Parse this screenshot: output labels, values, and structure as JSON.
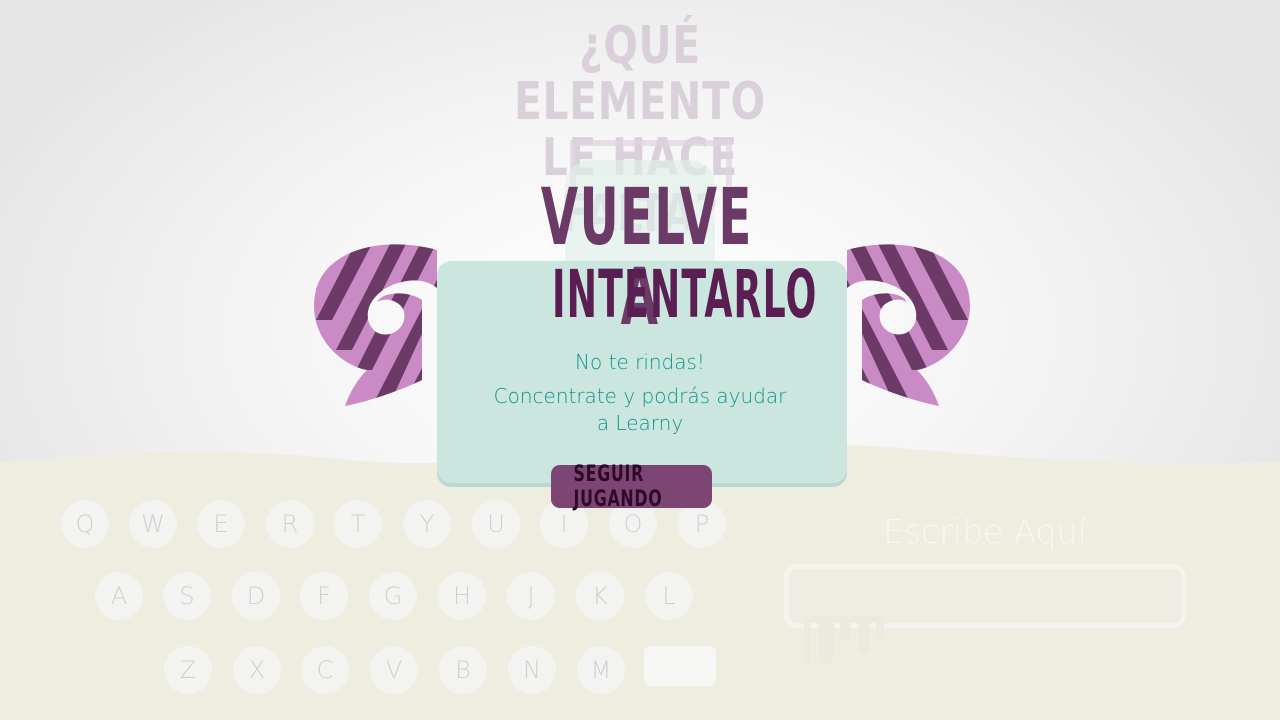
{
  "background": {
    "title_line1": "¿QUÉ ELEMENTO",
    "title_line2": "LE HACE FALTA?"
  },
  "keyboard": {
    "row1": [
      "Q",
      "W",
      "E",
      "R",
      "T",
      "Y",
      "U",
      "I",
      "O",
      "P"
    ],
    "row2": [
      "A",
      "S",
      "D",
      "F",
      "G",
      "H",
      "J",
      "K",
      "L"
    ],
    "row3": [
      "Z",
      "X",
      "C",
      "V",
      "B",
      "N",
      "M"
    ],
    "action_key": ""
  },
  "answer": {
    "label": "Escribe Aquí",
    "value": ""
  },
  "modal": {
    "title_line1": "VUELVE A",
    "title_line2": "INTENTARLO",
    "message1": "No te rindas!",
    "message2": "Concentrate y podrás ayudar",
    "message3": "a Learny",
    "button_label": "SEGUIR JUGANDO"
  },
  "colors": {
    "panel": "#cbe6df",
    "title": "#6b3a67",
    "button": "#7d4574",
    "message": "#11958a",
    "horn_light": "#c98ac6",
    "horn_dark": "#6b3a67"
  }
}
